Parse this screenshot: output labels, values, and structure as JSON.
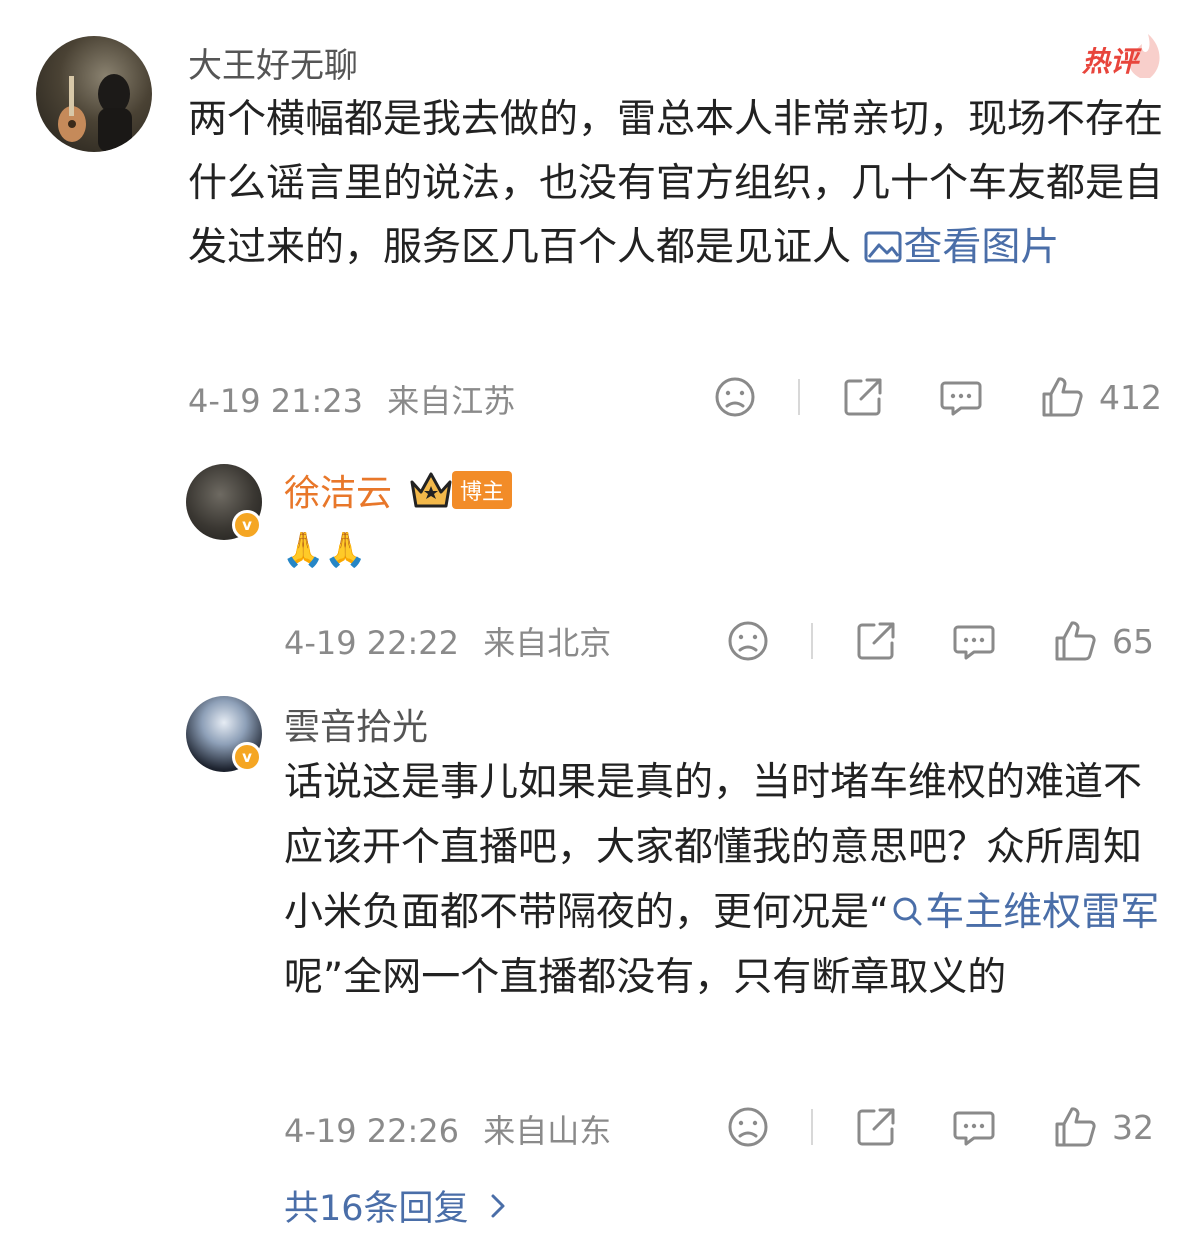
{
  "hot_badge": "热评",
  "comment_main": {
    "user": "大王好无聊",
    "text": "两个横幅都是我去做的，雷总本人非常亲切，现场不存在什么谣言里的说法，也没有官方组织，几十个车友都是自发过来的，服务区几百个人都是见证人",
    "view_image": "查看图片",
    "time": "4-19 21:23",
    "location": "来自江苏",
    "likes": "412",
    "icons": [
      "dislike-icon",
      "share-icon",
      "comment-icon",
      "like-icon"
    ]
  },
  "replies": [
    {
      "user": "徐洁云",
      "badge": "博主",
      "user_color": "#e8772a",
      "text": "🙏🙏",
      "time": "4-19 22:22",
      "location": "来自北京",
      "likes": "65"
    },
    {
      "user": "雲音拾光",
      "text_before": "话说这是事儿如果是真的，当时堵车维权的难道不应该开个直播吧，大家都懂我的意思吧？众所周知小米负面都不带隔夜的，更何况是“",
      "topic": "车主维权雷军",
      "text_after": " 呢”全网一个直播都没有，只有断章取义的",
      "time": "4-19 22:26",
      "location": "来自山东",
      "likes": "32"
    }
  ],
  "more_replies": "共16条回复",
  "colors": {
    "link": "#4a6ea8",
    "hot": "#e8453c",
    "verified": "#f5a623",
    "meta": "#8a8a8a"
  }
}
